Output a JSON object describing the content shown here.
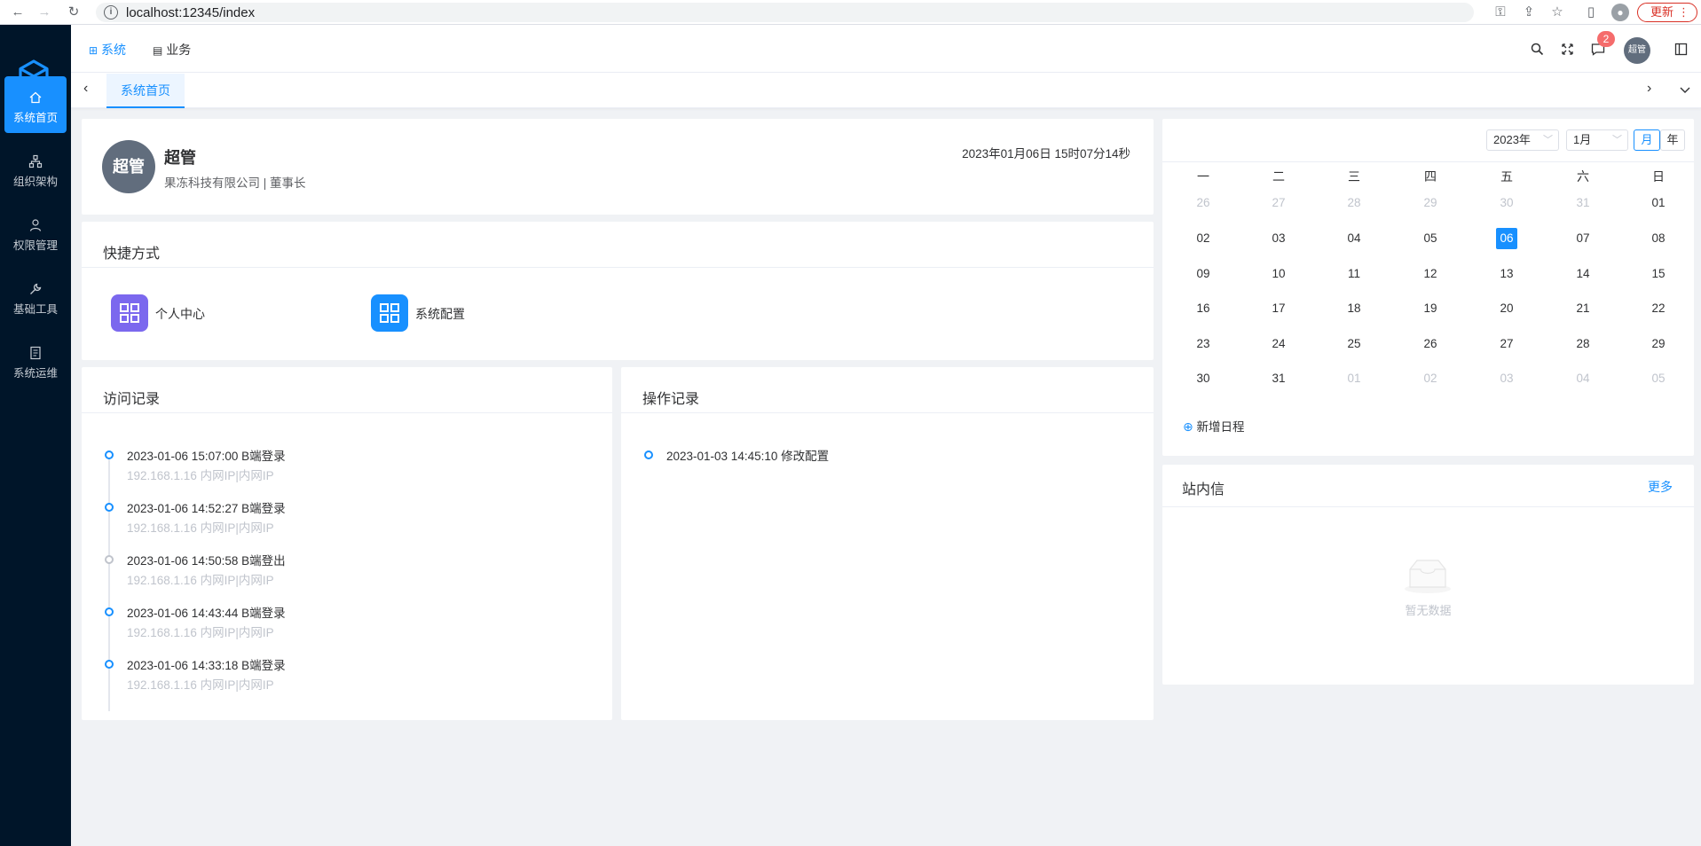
{
  "browser": {
    "url": "localhost:12345/index",
    "update_label": "更新"
  },
  "sidebar": {
    "items": [
      {
        "label": "系统首页",
        "icon": "home-icon"
      },
      {
        "label": "组织架构",
        "icon": "org-icon"
      },
      {
        "label": "权限管理",
        "icon": "user-icon"
      },
      {
        "label": "基础工具",
        "icon": "wrench-icon"
      },
      {
        "label": "系统运维",
        "icon": "doc-icon"
      }
    ]
  },
  "topnav": {
    "menus": [
      {
        "label": "系统",
        "icon": "grid-icon"
      },
      {
        "label": "业务",
        "icon": "doc-icon"
      }
    ],
    "notification_count": "2",
    "avatar_text": "超管"
  },
  "tabs": {
    "items": [
      {
        "label": "系统首页"
      }
    ]
  },
  "profile": {
    "avatar": "超管",
    "name": "超管",
    "org": "果冻科技有限公司 | 董事长",
    "datetime": "2023年01月06日 15时07分14秒"
  },
  "shortcuts": {
    "title": "快捷方式",
    "items": [
      {
        "label": "个人中心",
        "color": "#7b68ee"
      },
      {
        "label": "系统配置",
        "color": "#1890ff"
      }
    ]
  },
  "visits": {
    "title": "访问记录",
    "items": [
      {
        "time": "2023-01-06 15:07:00 B端登录",
        "sub": "192.168.1.16 内网IP|内网IP"
      },
      {
        "time": "2023-01-06 14:52:27 B端登录",
        "sub": "192.168.1.16 内网IP|内网IP"
      },
      {
        "time": "2023-01-06 14:50:58 B端登出",
        "sub": "192.168.1.16 内网IP|内网IP"
      },
      {
        "time": "2023-01-06 14:43:44 B端登录",
        "sub": "192.168.1.16 内网IP|内网IP"
      },
      {
        "time": "2023-01-06 14:33:18 B端登录",
        "sub": "192.168.1.16 内网IP|内网IP"
      }
    ]
  },
  "operations": {
    "title": "操作记录",
    "items": [
      {
        "time": "2023-01-03 14:45:10 修改配置"
      }
    ]
  },
  "calendar": {
    "year": "2023年",
    "month": "1月",
    "mode_month": "月",
    "mode_year": "年",
    "weekdays": [
      "一",
      "二",
      "三",
      "四",
      "五",
      "六",
      "日"
    ],
    "weeks": [
      [
        "26",
        "27",
        "28",
        "29",
        "30",
        "31",
        "01"
      ],
      [
        "02",
        "03",
        "04",
        "05",
        "06",
        "07",
        "08"
      ],
      [
        "09",
        "10",
        "11",
        "12",
        "13",
        "14",
        "15"
      ],
      [
        "16",
        "17",
        "18",
        "19",
        "20",
        "21",
        "22"
      ],
      [
        "23",
        "24",
        "25",
        "26",
        "27",
        "28",
        "29"
      ],
      [
        "30",
        "31",
        "01",
        "02",
        "03",
        "04",
        "05"
      ]
    ],
    "today": "06",
    "add_label": "新增日程"
  },
  "messages": {
    "title": "站内信",
    "more": "更多",
    "empty": "暂无数据"
  }
}
